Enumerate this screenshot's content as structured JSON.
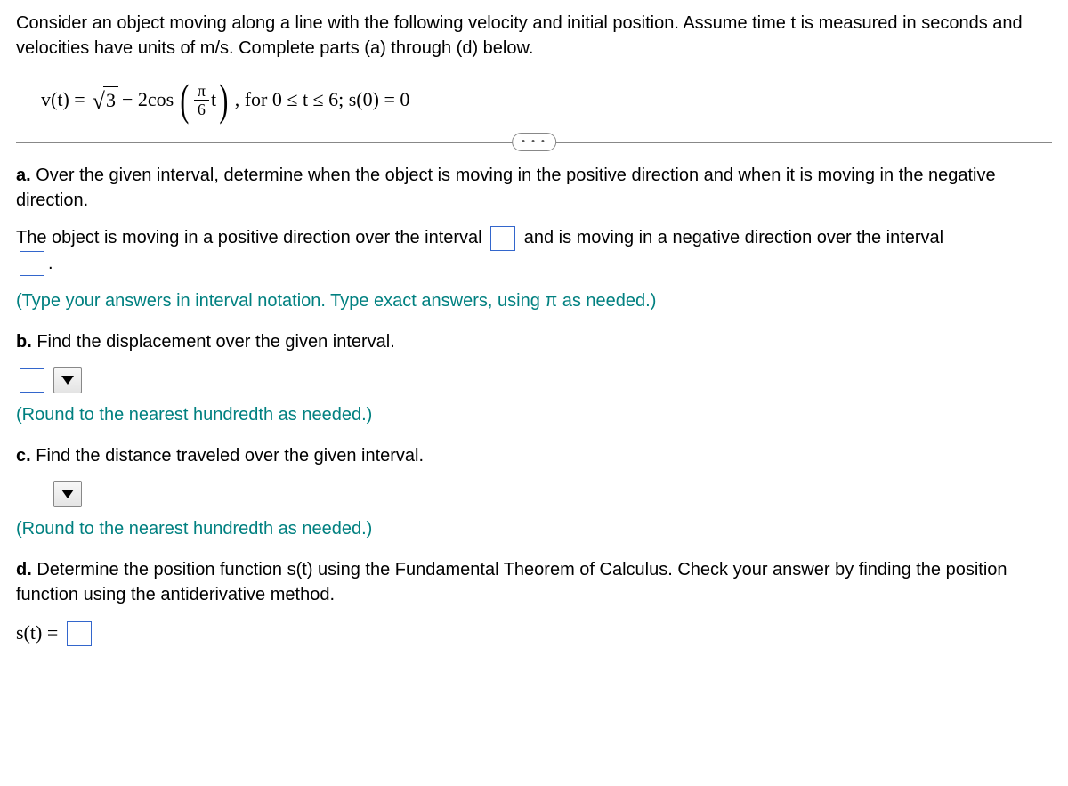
{
  "intro": "Consider an object moving along a line with the following velocity and initial position. Assume time t is measured in seconds and velocities have units of m/s. Complete parts (a) through (d) below.",
  "formula": {
    "lhs": "v(t) = ",
    "sqrt_radicand": "3",
    "minus2cos": " − 2cos",
    "frac_num": "π",
    "frac_den": "6",
    "after_frac": "t",
    "tail": ", for 0 ≤ t ≤ 6; s(0) = 0"
  },
  "dots": "• • •",
  "a": {
    "label": "a.",
    "prompt": " Over the given interval, determine when the object is moving in the positive direction and when it is moving in the negative direction.",
    "sentence_pre": "The object is moving in a positive direction over the interval ",
    "sentence_mid": " and is moving in a negative direction over the interval ",
    "sentence_end": ".",
    "hint": "(Type your answers in interval notation. Type exact answers, using π as needed.)"
  },
  "b": {
    "label": "b.",
    "prompt": " Find the displacement over the given interval.",
    "hint": "(Round to the nearest hundredth as needed.)"
  },
  "c": {
    "label": "c.",
    "prompt": " Find the distance traveled over the given interval.",
    "hint": "(Round to the nearest hundredth as needed.)"
  },
  "d": {
    "label": "d.",
    "prompt": " Determine the position function s(t) using the Fundamental Theorem of Calculus. Check your answer by finding the position function using the antiderivative method.",
    "eq_lhs": "s(t) ="
  }
}
